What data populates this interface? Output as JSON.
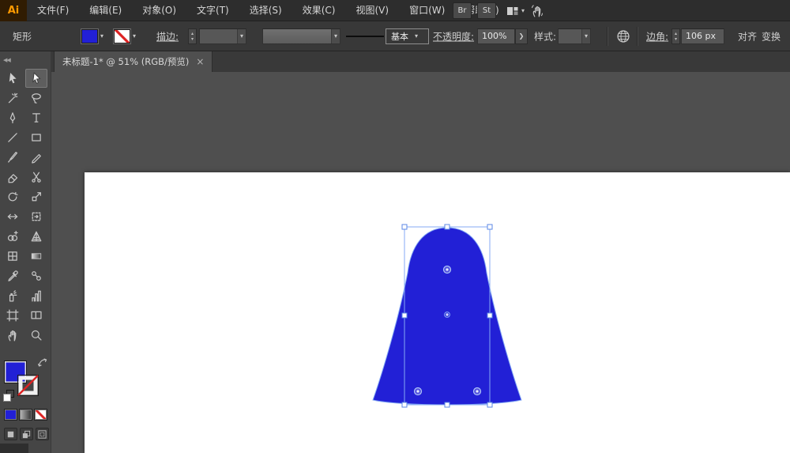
{
  "menu_bar": {
    "logo": "Ai",
    "items": [
      {
        "id": "file",
        "label": "文件(F)"
      },
      {
        "id": "edit",
        "label": "编辑(E)"
      },
      {
        "id": "object",
        "label": "对象(O)"
      },
      {
        "id": "type",
        "label": "文字(T)"
      },
      {
        "id": "select",
        "label": "选择(S)"
      },
      {
        "id": "effect",
        "label": "效果(C)"
      },
      {
        "id": "view",
        "label": "视图(V)"
      },
      {
        "id": "window",
        "label": "窗口(W)"
      },
      {
        "id": "help",
        "label": "帮助(H)"
      }
    ],
    "bridge": "Br",
    "stock": "St"
  },
  "control_bar": {
    "object_label": "矩形",
    "stroke_label": "描边:",
    "stroke_width_value": "",
    "brush_name": "基本",
    "opacity_label": "不透明度:",
    "opacity_value": "100%",
    "opacity_expand": "❯",
    "style_label": "样式:",
    "corner_label": "边角:",
    "corner_value": "106 px",
    "align_label": "对齐",
    "transform_label": "变换"
  },
  "tab_bar": {
    "active_tab": {
      "title": "未标题-1* @ 51% (RGB/预览)",
      "close": "×"
    }
  },
  "toolbar": {
    "collapse_glyph": "◀◀",
    "tools": [
      {
        "id": "selection-tool",
        "label": "选择工具"
      },
      {
        "id": "direct-selection-tool",
        "label": "直接选择工具",
        "active": true
      },
      {
        "id": "magic-wand-tool",
        "label": "魔棒工具"
      },
      {
        "id": "lasso-tool",
        "label": "套索工具"
      },
      {
        "id": "pen-tool",
        "label": "钢笔工具"
      },
      {
        "id": "type-tool",
        "label": "文字工具"
      },
      {
        "id": "line-segment-tool",
        "label": "直线段工具"
      },
      {
        "id": "rectangle-tool",
        "label": "矩形工具"
      },
      {
        "id": "paintbrush-tool",
        "label": "画笔工具"
      },
      {
        "id": "pencil-tool",
        "label": "铅笔工具"
      },
      {
        "id": "eraser-tool",
        "label": "橡皮擦工具"
      },
      {
        "id": "scissors-tool",
        "label": "剪刀工具"
      },
      {
        "id": "rotate-tool",
        "label": "旋转工具"
      },
      {
        "id": "scale-tool",
        "label": "比例缩放工具"
      },
      {
        "id": "width-tool",
        "label": "宽度工具"
      },
      {
        "id": "free-transform-tool",
        "label": "自由变换工具"
      },
      {
        "id": "shape-builder-tool",
        "label": "形状生成器工具"
      },
      {
        "id": "perspective-grid-tool",
        "label": "透视网格工具"
      },
      {
        "id": "mesh-tool",
        "label": "网格工具"
      },
      {
        "id": "gradient-tool",
        "label": "渐变工具"
      },
      {
        "id": "eyedropper-tool",
        "label": "吸管工具"
      },
      {
        "id": "blend-tool",
        "label": "混合工具"
      },
      {
        "id": "symbol-sprayer-tool",
        "label": "符号喷枪工具"
      },
      {
        "id": "column-graph-tool",
        "label": "柱形图工具"
      },
      {
        "id": "artboard-tool",
        "label": "画板工具"
      },
      {
        "id": "slice-tool",
        "label": "切片工具"
      },
      {
        "id": "hand-tool",
        "label": "抓手工具"
      },
      {
        "id": "zoom-tool",
        "label": "缩放工具"
      }
    ]
  },
  "canvas": {
    "shape": {
      "type": "rounded-rectangle-bell",
      "corner_radius": "106 px"
    }
  },
  "colors": {
    "fill_blue": "#2220d6",
    "selection_blue": "#84a9f4",
    "logo_orange": "#ff9a00",
    "none_red": "#dd2222"
  }
}
